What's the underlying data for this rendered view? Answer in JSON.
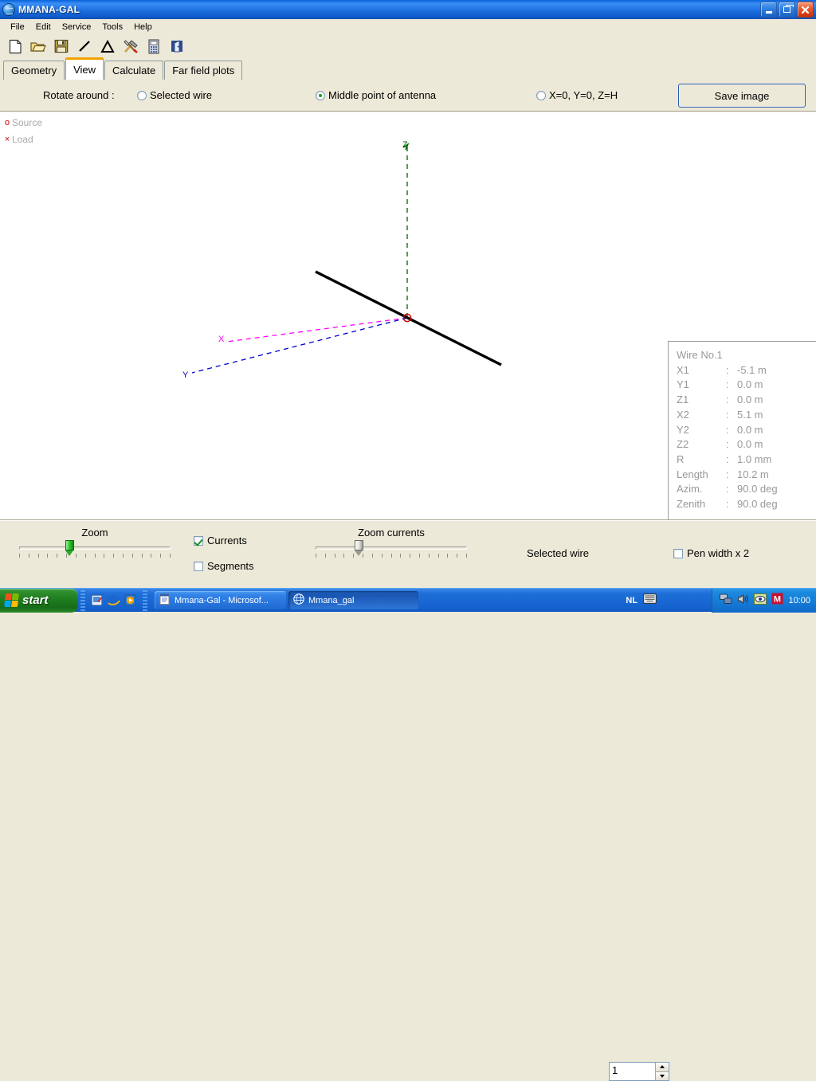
{
  "window": {
    "title": "MMANA-GAL",
    "icon": "globe-icon",
    "buttons": {
      "minimize": "minimize-icon",
      "restore": "restore-icon",
      "close": "close-icon"
    }
  },
  "menu": {
    "items": [
      "File",
      "Edit",
      "Service",
      "Tools",
      "Help"
    ]
  },
  "toolbar": {
    "items": [
      {
        "name": "new-file-icon",
        "title": "New"
      },
      {
        "name": "open-folder-icon",
        "title": "Open"
      },
      {
        "name": "save-disk-icon",
        "title": "Save"
      },
      {
        "name": "wire-line-icon",
        "title": "Wire"
      },
      {
        "name": "triangle-icon",
        "title": "Element"
      },
      {
        "name": "tools-hammer-icon",
        "title": "Tools"
      },
      {
        "name": "calculator-icon",
        "title": "Calculator"
      },
      {
        "name": "exit-door-icon",
        "title": "Exit"
      }
    ]
  },
  "tabs": {
    "items": [
      {
        "label": "Geometry",
        "active": false
      },
      {
        "label": "View",
        "active": true
      },
      {
        "label": "Calculate",
        "active": false
      },
      {
        "label": "Far field plots",
        "active": false
      }
    ]
  },
  "options": {
    "rotate_label": "Rotate around :",
    "radios": [
      {
        "label": "Selected wire",
        "checked": false
      },
      {
        "label": "Middle point of antenna",
        "checked": true
      },
      {
        "label": "X=0, Y=0, Z=H",
        "checked": false
      }
    ],
    "save_image_label": "Save image",
    "accent_color": "#1a9c1a"
  },
  "canvas": {
    "legend": [
      {
        "marker": "o",
        "label": "Source",
        "color": "#d00000"
      },
      {
        "marker": "×",
        "label": "Load",
        "color": "#d00000"
      }
    ],
    "axes": [
      {
        "name": "X",
        "label": "X",
        "color": "#ff00ff"
      },
      {
        "name": "Y",
        "label": "Y",
        "color": "#0000cc"
      },
      {
        "name": "Z",
        "label": "Z",
        "color": "#006400"
      }
    ],
    "wire_color": "#000000",
    "source_marker_color": "#d00000"
  },
  "wire_info": {
    "title": "Wire No.1",
    "rows": [
      {
        "key": "X1",
        "sep": ":",
        "value": "-5.1 m"
      },
      {
        "key": "Y1",
        "sep": ":",
        "value": "0.0 m"
      },
      {
        "key": "Z1",
        "sep": ":",
        "value": "0.0 m"
      },
      {
        "key": "X2",
        "sep": ":",
        "value": "5.1 m"
      },
      {
        "key": "Y2",
        "sep": ":",
        "value": "0.0 m"
      },
      {
        "key": "Z2",
        "sep": ":",
        "value": "0.0 m"
      },
      {
        "key": "R",
        "sep": ":",
        "value": "1.0 mm"
      },
      {
        "key": "Length",
        "sep": ":",
        "value": "10.2 m"
      },
      {
        "key": "Azim.",
        "sep": ":",
        "value": "90.0 deg"
      },
      {
        "key": "Zenith",
        "sep": ":",
        "value": "90.0 deg"
      }
    ]
  },
  "controls": {
    "zoom": {
      "label": "Zoom",
      "value": 33
    },
    "zoom_currents": {
      "label": "Zoom currents",
      "value": 28
    },
    "checkboxes": [
      {
        "label": "Currents",
        "checked": true
      },
      {
        "label": "Segments",
        "checked": false
      },
      {
        "label": "Pen width x 2",
        "checked": false
      }
    ],
    "selected_wire": {
      "label": "Selected wire",
      "value": "1"
    }
  },
  "taskbar": {
    "start_label": "start",
    "quick_launch": [
      "show-desktop-icon",
      "internet-explorer-icon",
      "media-player-icon"
    ],
    "tasks": [
      {
        "label": "Mmana-Gal - Microsof...",
        "icon": "word-document-icon",
        "active": false
      },
      {
        "label": "Mmana_gal",
        "icon": "globe-icon",
        "active": true
      }
    ],
    "language": "NL",
    "tray_icons": [
      "keyboard-icon",
      "network-icon",
      "volume-icon",
      "eye-icon",
      "m-icon"
    ],
    "clock": "10:00"
  }
}
